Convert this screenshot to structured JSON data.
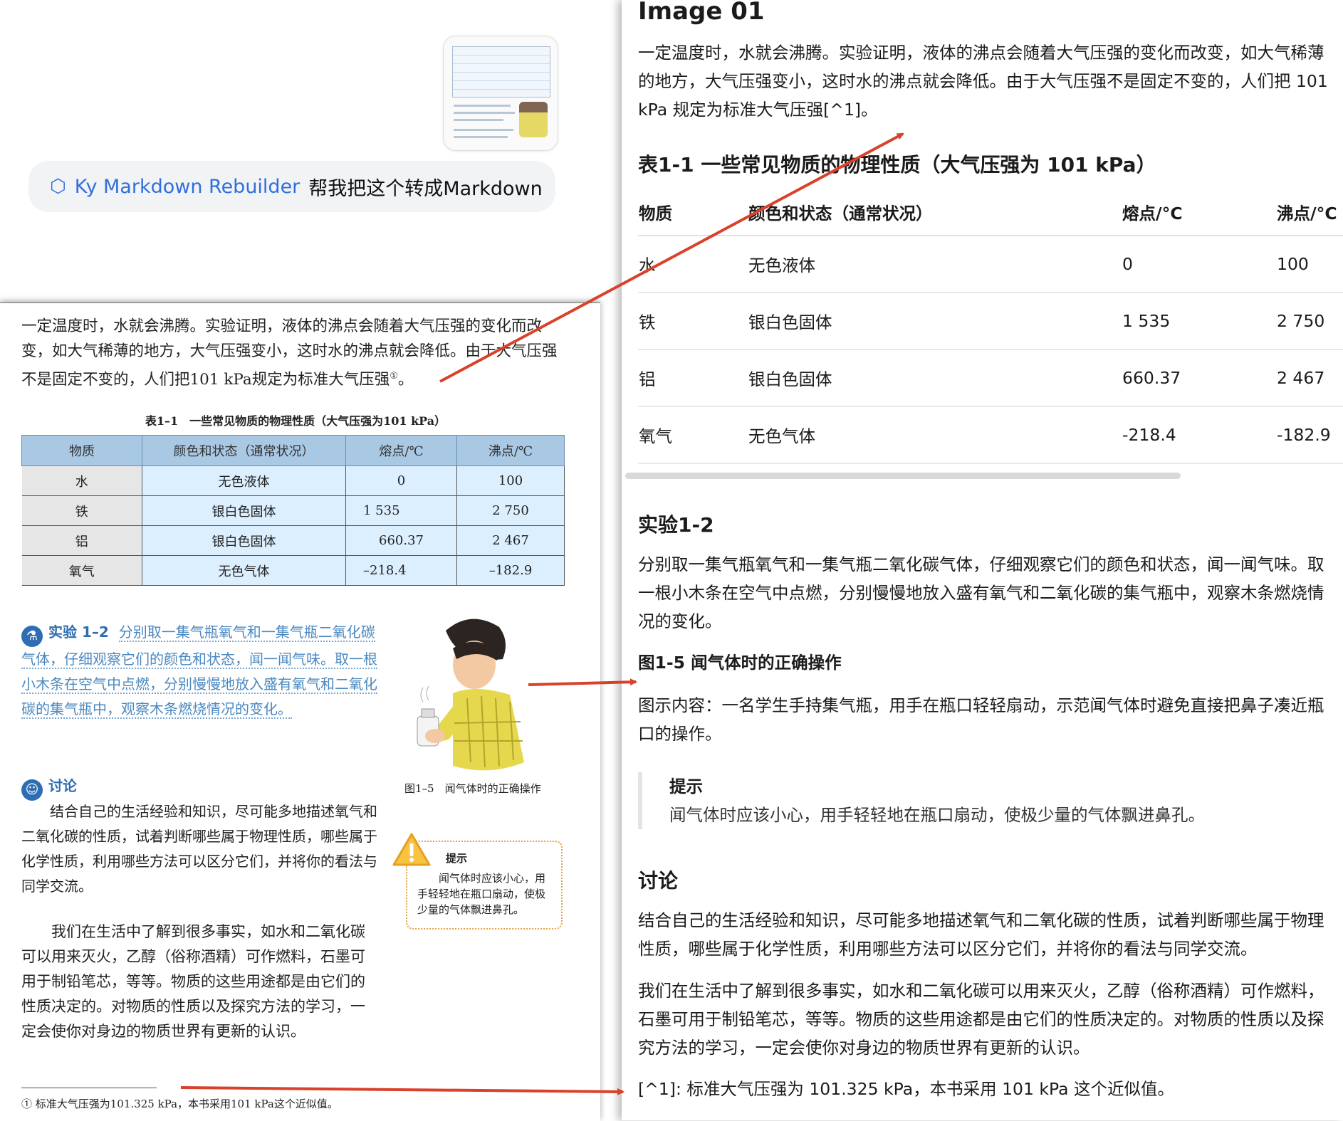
{
  "chat": {
    "app_name": "Ky Markdown Rebuilder",
    "message": "帮我把这个转成Markdown",
    "thumbnail_icon": "image-thumbnail",
    "app_icon": "cube-icon"
  },
  "book": {
    "intro": "一定温度时，水就会沸腾。实验证明，液体的沸点会随着大气压强的变化而改变，如大气稀薄的地方，大气压强变小，这时水的沸点就会降低。由于大气压强不是固定不变的，人们把101 kPa规定为标准大气压强",
    "intro_mark": "①",
    "table_caption": "表1–1　一些常见物质的物理性质（大气压强为101 kPa）",
    "table_headers": [
      "物质",
      "颜色和状态（通常状况）",
      "熔点/℃",
      "沸点/℃"
    ],
    "table_rows": [
      [
        "水",
        "无色液体",
        "0",
        "100"
      ],
      [
        "铁",
        "银白色固体",
        "1 535",
        "2 750"
      ],
      [
        "铝",
        "银白色固体",
        "660.37",
        "2 467"
      ],
      [
        "氧气",
        "无色气体",
        "–218.4",
        "–182.9"
      ]
    ],
    "experiment_label": "实验 1–2",
    "experiment_text": "分别取一集气瓶氧气和一集气瓶二氧化碳气体，仔细观察它们的颜色和状态，闻一闻气味。取一根小木条在空气中点燃，分别慢慢地放入盛有氧气和二氧化碳的集气瓶中，观察木条燃烧情况的变化。",
    "figure_caption": "图1–5　闻气体时的正确操作",
    "discussion_label": "讨论",
    "discussion_text": "结合自己的生活经验和知识，尽可能多地描述氧气和二氧化碳的性质，试着判断哪些属于物理性质，哪些属于化学性质，利用哪些方法可以区分它们，并将你的看法与同学交流。",
    "tip_label": "提示",
    "tip_text": "闻气体时应该小心，用手轻轻地在瓶口扇动，使极少量的气体飘进鼻孔。",
    "para2": "我们在生活中了解到很多事实，如水和二氧化碳可以用来灭火，乙醇（俗称酒精）可作燃料，石墨可用于制铅笔芯，等等。物质的这些用途都是由它们的性质决定的。对物质的性质以及探究方法的学习，一定会使你对身边的物质世界有更新的认识。",
    "footnote": "① 标准大气压强为101.325 kPa，本书采用101 kPa这个近似值。"
  },
  "markdown": {
    "title": "Image 01",
    "intro": "一定温度时，水就会沸腾。实验证明，液体的沸点会随着大气压强的变化而改变，如大气稀薄的地方，大气压强变小，这时水的沸点就会降低。由于大气压强不是固定不变的，人们把 101 kPa 规定为标准大气压强[^1]。",
    "table_title": "表1-1 一些常见物质的物理性质（大气压强为 101 kPa）",
    "table_headers": [
      "物质",
      "颜色和状态（通常状况）",
      "熔点/°C",
      "沸点/°C"
    ],
    "table_rows": [
      [
        "水",
        "无色液体",
        "0",
        "100"
      ],
      [
        "铁",
        "银白色固体",
        "1 535",
        "2 750"
      ],
      [
        "铝",
        "银白色固体",
        "660.37",
        "2 467"
      ],
      [
        "氧气",
        "无色气体",
        "-218.4",
        "-182.9"
      ]
    ],
    "exp_heading": "实验1-2",
    "exp_text": "分别取一集气瓶氧气和一集气瓶二氧化碳气体，仔细观察它们的颜色和状态，闻一闻气味。取一根小木条在空气中点燃，分别慢慢地放入盛有氧气和二氧化碳的集气瓶中，观察木条燃烧情况的变化。",
    "fig_heading": "图1-5 闻气体时的正确操作",
    "fig_desc": "图示内容：一名学生手持集气瓶，用手在瓶口轻轻扇动，示范闻气体时避免直接把鼻子凑近瓶口的操作。",
    "tip_title": "提示",
    "tip_text": "闻气体时应该小心，用手轻轻地在瓶口扇动，使极少量的气体飘进鼻孔。",
    "disc_heading": "讨论",
    "disc_text": "结合自己的生活经验和知识，尽可能多地描述氧气和二氧化碳的性质，试着判断哪些属于物理性质，哪些属于化学性质，利用哪些方法可以区分它们，并将你的看法与同学交流。",
    "para2": "我们在生活中了解到很多事实，如水和二氧化碳可以用来灭火，乙醇（俗称酒精）可作燃料，石墨可用于制铅笔芯，等等。物质的这些用途都是由它们的性质决定的。对物质的性质以及探究方法的学习，一定会使你对身边的物质世界有更新的认识。",
    "footnote": "[^1]: 标准大气压强为 101.325 kPa，本书采用 101 kPa 这个近似值。"
  },
  "colors": {
    "accent_blue": "#2f6fdc",
    "arrow_red": "#d9412b",
    "table_header_blue": "#a9c8e4",
    "table_cell_blue": "#dcefff"
  }
}
